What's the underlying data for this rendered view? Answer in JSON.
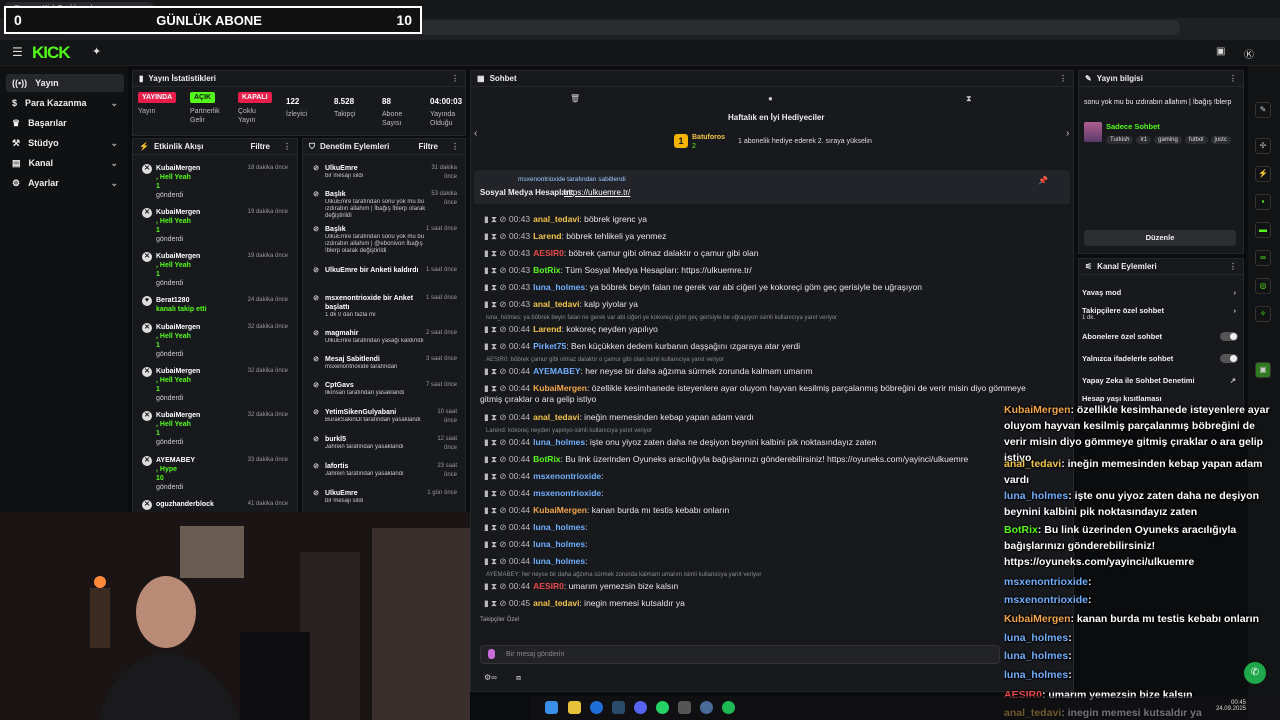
{
  "browser": {
    "tab_title": "Stream - Kick Dashboard",
    "url": "https://dashboard.kick.com/stream"
  },
  "overlay_abone": {
    "left": "0",
    "title": "GÜNLÜK ABONE",
    "count": "10"
  },
  "header": {
    "logo": "KICK"
  },
  "sidebar": {
    "items": [
      {
        "label": "Yayın"
      },
      {
        "label": "Para Kazanma"
      },
      {
        "label": "Başarılar"
      },
      {
        "label": "Stüdyo"
      },
      {
        "label": "Kanal"
      },
      {
        "label": "Ayarlar"
      }
    ]
  },
  "stats": {
    "title": "Yayın İstatistikleri",
    "items": [
      {
        "badge": "YAYINDA",
        "label": "Yayın",
        "color": "#e91e4a"
      },
      {
        "badge": "AÇIK",
        "label": "Partnerlik Gelir",
        "color": "#53fc18"
      },
      {
        "badge": "KAPALI",
        "label": "Çoklu Yayın",
        "color": "#e91e4a"
      },
      {
        "value": "122",
        "label": "İzleyici"
      },
      {
        "value": "8.528",
        "label": "Takipçi"
      },
      {
        "value": "88",
        "label": "Abone Sayısı"
      },
      {
        "value": "04:00:03",
        "label": "Yayında Olduğu"
      }
    ]
  },
  "activity": {
    "title": "Etkinlik Akışı",
    "filter": "Filtre",
    "items": [
      {
        "user": "KubaiMergen",
        "line1": ", Hell Yeah",
        "line2": "1",
        "line3": "gönderdi",
        "time": "18 dakika önce"
      },
      {
        "user": "KubaiMergen",
        "line1": ", Hell Yeah",
        "line2": "1",
        "line3": "gönderdi",
        "time": "19 dakika önce"
      },
      {
        "user": "KubaiMergen",
        "line1": ", Hell Yeah",
        "line2": "1",
        "line3": "gönderdi",
        "time": "19 dakika önce"
      },
      {
        "user": "Berat1280",
        "line1": "kanalı takip etti",
        "line2": "",
        "line3": "",
        "time": "24 dakika önce"
      },
      {
        "user": "KubaiMergen",
        "line1": ", Hell Yeah",
        "line2": "1",
        "line3": "gönderdi",
        "time": "32 dakika önce"
      },
      {
        "user": "KubaiMergen",
        "line1": ", Hell Yeah",
        "line2": "1",
        "line3": "gönderdi",
        "time": "32 dakika önce"
      },
      {
        "user": "KubaiMergen",
        "line1": ", Hell Yeah",
        "line2": "1",
        "line3": "gönderdi",
        "time": "32 dakika önce"
      },
      {
        "user": "AYEMABEY",
        "line1": ", Hype",
        "line2": "10",
        "line3": "gönderdi",
        "time": "33 dakika önce"
      },
      {
        "user": "oguzhanderblock",
        "line1": "",
        "line2": "",
        "line3": "",
        "time": "41 dakika önce"
      }
    ]
  },
  "moderation": {
    "title": "Denetim Eylemleri",
    "filter": "Filtre",
    "items": [
      {
        "user": "UlkuEmre",
        "text": "bir mesajı sildi",
        "time": "31 dakika önce"
      },
      {
        "user": "Başlık",
        "text": "UlkuEmre tarafından sonu yok mu bu ızdırabın allahım | İbağış !blerp olarak değiştirildi",
        "time": "53 dakika önce"
      },
      {
        "user": "Başlık",
        "text": "UlkuEmre tarafından sonu yok mu bu ızdırabın allahım | @ebonivon İbağış !blerp olarak değiştirildi",
        "time": "1 saat önce"
      },
      {
        "user": "UlkuEmre bir Anketi kaldırdı",
        "text": "",
        "time": "1 saat önce"
      },
      {
        "user": "msxenontrioxide bir Anket başlattı",
        "text": "1 dk 0 dan fazla mı",
        "time": "1 saat önce"
      },
      {
        "user": "magmahir",
        "text": "UlkuEmre tarafından yasağı kaldırıldı",
        "time": "2 saat önce"
      },
      {
        "user": "Mesaj Sabitlendi",
        "text": "msxenontrioxide tarafından",
        "time": "3 saat önce"
      },
      {
        "user": "CptGavs",
        "text": "İlkinsan tarafından yasaklandı",
        "time": "7 saat önce"
      },
      {
        "user": "YetimSikenGulyabani",
        "text": "BurakSakinOl tarafından yasaklandı",
        "time": "10 saat önce"
      },
      {
        "user": "burkl5",
        "text": "Jahrein tarafından yasaklandı",
        "time": "12 saat önce"
      },
      {
        "user": "lafortis",
        "text": "Jahrein tarafından yasaklandı",
        "time": "23 saat önce"
      },
      {
        "user": "UlkuEmre",
        "text": "bir mesajı sildi",
        "time": "1 gün önce"
      }
    ]
  },
  "chat": {
    "title": "Sohbet",
    "gifters_title": "Haftalık en İyi Hediyeciler",
    "gifter_name": "Batuforos",
    "gifter_count": "2",
    "gifter_hint": "1 abonelik hediye ederek 2. sıraya yükselin",
    "pinned_by": "msxenontrioxide tarafından sabitlendi",
    "pinned_text": "Sosyal Medya Hesapları:",
    "pinned_link": "https://ulkuemre.tr/",
    "input_placeholder": "Bir mesaj gönderin",
    "followers_only": "Takipçiler Özel",
    "messages": [
      {
        "time": "00:43",
        "user": "anal_tedavi",
        "color": "#f4c54a",
        "text": ": böbrek igrenc ya"
      },
      {
        "time": "00:43",
        "user": "Larend",
        "color": "#f4c54a",
        "text": ": böbrek tehlikeli ya yenmez"
      },
      {
        "time": "00:43",
        "user": "AESIR0",
        "color": "#e94b4b",
        "text": ": böbrek çamur gibi olmaz dalaktır o çamur gibi olan"
      },
      {
        "time": "00:43",
        "user": "BotRix",
        "color": "#53fc18",
        "text": ": Tüm Sosyal Medya Hesapları: https://ulkuemre.tr/"
      },
      {
        "time": "00:43",
        "user": "luna_holmes",
        "color": "#6fb0ff",
        "text": ": ya böbrek beyin falan ne gerek var abi ciğeri ye kokoreçi göm geç gerisiyle be uğraşıyon"
      },
      {
        "time": "00:43",
        "user": "anal_tedavi",
        "color": "#f4c54a",
        "text": ": kalp yiyolar ya"
      },
      {
        "time": "00:44",
        "user": "Larend",
        "color": "#f4c54a",
        "text": ": kokoreç neyden yapılıyo"
      },
      {
        "time": "00:44",
        "user": "Pirket75",
        "color": "#6fb0ff",
        "text": ": Ben küçükken dedem kurbanın daşşağını ızgaraya atar yerdi"
      },
      {
        "time": "00:44",
        "user": "AYEMABEY",
        "color": "#6fb0ff",
        "text": ": her neyse bir daha ağzıma sürmek zorunda kalmam umarım"
      },
      {
        "time": "00:44",
        "user": "KubaiMergen",
        "color": "#f4a64a",
        "text": ": özellikle kesimhanede isteyenlere ayar oluyom hayvan kesilmiş parçalanmış böbreğini de verir misin diyo gömmeye"
      },
      {
        "time": "",
        "user": "",
        "color": "#e6e6e6",
        "text": "gitmiş çıraklar o ara gelip istiyo"
      },
      {
        "time": "00:44",
        "user": "anal_tedavi",
        "color": "#f4c54a",
        "text": ": ineğin memesinden kebap yapan adam vardı"
      },
      {
        "time": "00:44",
        "user": "luna_holmes",
        "color": "#6fb0ff",
        "text": ": işte onu yiyoz zaten daha ne deşiyon beynini kalbini pik noktasındayız zaten"
      },
      {
        "time": "00:44",
        "user": "BotRix",
        "color": "#53fc18",
        "text": ": Bu link üzerinden Oyuneks aracılığıyla bağışlarınızı gönderebilirsiniz! https://oyuneks.com/yayinci/ulkuemre"
      },
      {
        "time": "00:44",
        "user": "msxenontrioxide",
        "color": "#6fb0ff",
        "text": ":"
      },
      {
        "time": "00:44",
        "user": "msxenontrioxide",
        "color": "#6fb0ff",
        "text": ":"
      },
      {
        "time": "00:44",
        "user": "KubaiMergen",
        "color": "#f4a64a",
        "text": ": kanan burda mı testis kebabı onların"
      },
      {
        "time": "00:44",
        "user": "luna_holmes",
        "color": "#6fb0ff",
        "text": ":"
      },
      {
        "time": "00:44",
        "user": "luna_holmes",
        "color": "#6fb0ff",
        "text": ":"
      },
      {
        "time": "00:44",
        "user": "luna_holmes",
        "color": "#6fb0ff",
        "text": ":"
      },
      {
        "time": "00:44",
        "user": "AESIR0",
        "color": "#e94b4b",
        "text": ": umarım yemezsin bize kalsın"
      },
      {
        "time": "00:45",
        "user": "anal_tedavi",
        "color": "#f4c54a",
        "text": ": inegin memesi kutsaldır ya"
      }
    ],
    "system_notes": [
      "luna_holmes: ya böbrek beyin falan ne gerek var abi ciğeri ye kokoreçi göm geç gerisiyle be uğraşıyon isimli kullanıcıya yanıt veriyor",
      "AESIR0: böbrek çamur gibi olmaz dalaktır o çamur gibi olan isimli kullanıcıya yanıt veriyor",
      "Larend: kokoreç neyden yapılıyo isimli kullanıcıya yanıt veriyor",
      "AYEMABEY: her neyse bir daha ağzıma sürmek zorunda kalmam umarım isimli kullanıcıya yanıt veriyor"
    ]
  },
  "stream_info": {
    "title": "Yayın bilgisi",
    "stream_title": "sonu yok mu bu ızdırabın allahım | İbağış !blerp",
    "category": "Sadece Sohbet",
    "tags": [
      "Turkish",
      "ir1",
      "gaming",
      "futbol",
      "justc"
    ],
    "edit": "Düzenle"
  },
  "channel_actions": {
    "title": "Kanal Eylemleri",
    "items": [
      {
        "label": "Yavaş mod",
        "kind": "chevron"
      },
      {
        "label": "Takipçilere özel sohbet",
        "sub": "1 dk.",
        "kind": "chevron"
      },
      {
        "label": "Abonelere özel sohbet",
        "kind": "toggle"
      },
      {
        "label": "Yalnızca ifadelerle sohbet",
        "kind": "toggle"
      },
      {
        "label": "Yapay Zeka ile Sohbet Denetimi",
        "kind": "link"
      },
      {
        "label": "Hesap yaşı kısıtlaması",
        "kind": "chevron"
      }
    ]
  },
  "overlay_chat": [
    {
      "user": "KubaiMergen",
      "color": "#f4a64a",
      "text": ": özellikle kesimhanede isteyenlere ayar oluyom hayvan kesilmiş parçalanmış böbreğini de verir misin diyo gömmeye gitmiş çıraklar o ara gelip istiyo"
    },
    {
      "user": "anal_tedavi",
      "color": "#f4c54a",
      "text": ": ineğin memesinden kebap yapan adam vardı"
    },
    {
      "user": "luna_holmes",
      "color": "#6fb0ff",
      "text": ": işte onu yiyoz zaten daha ne deşiyon beynini kalbini pik noktasındayız zaten"
    },
    {
      "user": "BotRix",
      "color": "#53fc18",
      "text": ": Bu link üzerinden Oyuneks aracılığıyla bağışlarınızı gönderebilirsiniz! https://oyuneks.com/yayinci/ulkuemre"
    },
    {
      "user": "msxenontrioxide",
      "color": "#6fb0ff",
      "text": ":"
    },
    {
      "user": "msxenontrioxide",
      "color": "#6fb0ff",
      "text": ":"
    },
    {
      "user": "KubaiMergen",
      "color": "#f4a64a",
      "text": ": kanan burda mı testis kebabı onların"
    },
    {
      "user": "luna_holmes",
      "color": "#6fb0ff",
      "text": ":"
    },
    {
      "user": "luna_holmes",
      "color": "#6fb0ff",
      "text": ":"
    },
    {
      "user": "luna_holmes",
      "color": "#6fb0ff",
      "text": ":"
    },
    {
      "user": "AESIR0",
      "color": "#e94b4b",
      "text": ": umarım yemezsin bize kalsın"
    },
    {
      "user": "anal_tedavi",
      "color": "#f4c54a",
      "text": ": inegin memesi kutsaldır ya"
    }
  ],
  "taskbar": {
    "time": "00:45",
    "date": "24.09.2025"
  }
}
